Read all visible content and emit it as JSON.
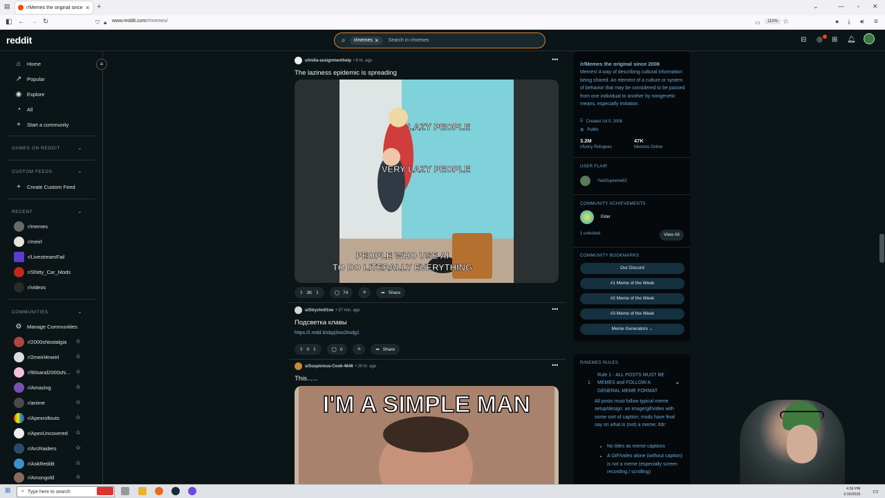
{
  "browser": {
    "tab_title": "r/Memes the original since 20",
    "url_host": "www.reddit.com",
    "url_path": "/r/memes/",
    "zoom": "110%"
  },
  "header": {
    "logo": "reddit",
    "search_chip": "r/memes",
    "search_placeholder": "Search in r/memes"
  },
  "sidebar": {
    "nav": [
      "Home",
      "Popular",
      "Explore",
      "All",
      "Start a community"
    ],
    "games_section": "GAMES ON REDDIT",
    "custom_feeds_section": "CUSTOM FEEDS",
    "create_custom_feed": "Create Custom Feed",
    "recent_section": "RECENT",
    "recent": [
      "r/memes",
      "r/meirl",
      "r/LivestreamFail",
      "r/Shitty_Car_Mods",
      "r/videos"
    ],
    "communities_section": "COMMUNITIES",
    "manage_communities": "Manage Communities",
    "communities": [
      "r/2000sNostalgia",
      "r/2meirl4meirl",
      "r/90sand2000sN...",
      "r/Amazing",
      "r/anime",
      "r/Apexrollouts",
      "r/ApexUncovered",
      "r/ArcRaiders",
      "r/AskReddit",
      "r/Amongold"
    ]
  },
  "posts": [
    {
      "user": "u/india-assignmenthelp",
      "time": "• 6 hr. ago",
      "title": "The laziness epidemic is spreading",
      "captions": [
        "LAZY PEOPLE",
        "VERY LAZY PEOPLE",
        "PEOPLE WHO USE AI",
        "TO DO LITERALLY EVERYTHING"
      ],
      "votes": "3K",
      "comments": "74",
      "share": "Share"
    },
    {
      "user": "u/Strychn01ne",
      "time": "• 37 min. ago",
      "title": "Подсветка клавы",
      "link": "https://i.redd.it/sbpj3xw2ksdg1",
      "votes": "0",
      "comments": "0",
      "share": "Share"
    },
    {
      "user": "u/Suspicious-Cook-4646",
      "time": "• 20 hr. ago",
      "title": "This......",
      "caption": "I'M A SIMPLE MAN"
    }
  ],
  "about": {
    "title": "/r/Memes the original since 2008",
    "description": "Memes! A way of describing cultural information being shared. An element of a culture or system of behavior that may be considered to be passed from one individual to another by nongenetic means, especially imitation.",
    "created": "Created Jul 5, 2008",
    "visibility": "Public",
    "members": "3.2M",
    "members_label": "r/funny Refugees",
    "online": "47K",
    "online_label": "Memists Online",
    "user_flair_section": "USER FLAIR",
    "user_flair": "YeetSupreme92",
    "achievements_section": "COMMUNITY ACHIEVEMENTS",
    "achievement": "Elder",
    "unlocked": "1 unlocked",
    "view_all": "View All",
    "bookmarks_section": "COMMUNITY BOOKMARKS",
    "bookmarks": [
      "Our Discord",
      "#1 Meme of the Week",
      "#2 Meme of the Week",
      "#3 Meme of the Week",
      "Meme Generators ⌄"
    ]
  },
  "rules": {
    "section": "R/MEMES RULES",
    "rule_number": "1",
    "rule_title": "Rule 1 - ALL POSTS MUST BE MEMES and FOLLOW A GENERAL MEME FORMAT",
    "rule_body": "All posts must follow typical meme setup/design: an image/gif/video with some sort of caption; mods have final say on what is (not) a meme; tldr:",
    "bullets": [
      "No titles as meme captions",
      "A GIF/video alone (without caption) is not a meme (especially screen recording / scrolling)"
    ]
  },
  "taskbar": {
    "search": "Type here to search",
    "time": "4:56 PM",
    "date": "1/16/2026"
  },
  "colors": {
    "background": "#0b1416",
    "accent": "#ff4500",
    "link": "#7bb8e8",
    "search_border": "#d9822b"
  }
}
